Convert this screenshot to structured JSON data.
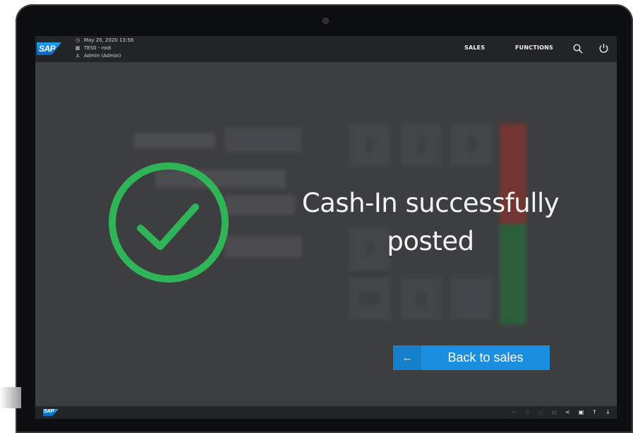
{
  "header": {
    "logo_text": "SAP",
    "datetime": "May 20, 2020 13:56",
    "store": "TES0 - root",
    "user": "Admin (Admin)",
    "nav": [
      "SALES",
      "FUNCTIONS"
    ],
    "icons": [
      "clock-icon",
      "store-icon",
      "user-icon",
      "search-icon",
      "power-icon"
    ]
  },
  "background": {
    "keypad": [
      "1",
      "2",
      "3",
      "7",
      "00",
      "0"
    ]
  },
  "dialog": {
    "message": "Cash-In successfully posted",
    "back_arrow": "←",
    "back_label": "Back to sales",
    "success_color": "#2fb557",
    "button_color": "#1a8fe0"
  },
  "footer": {
    "logo_text": "SAP",
    "tools": [
      "⇐",
      "⎙",
      "⎌",
      "▤",
      "<",
      "▣",
      "↑",
      "↓"
    ]
  }
}
